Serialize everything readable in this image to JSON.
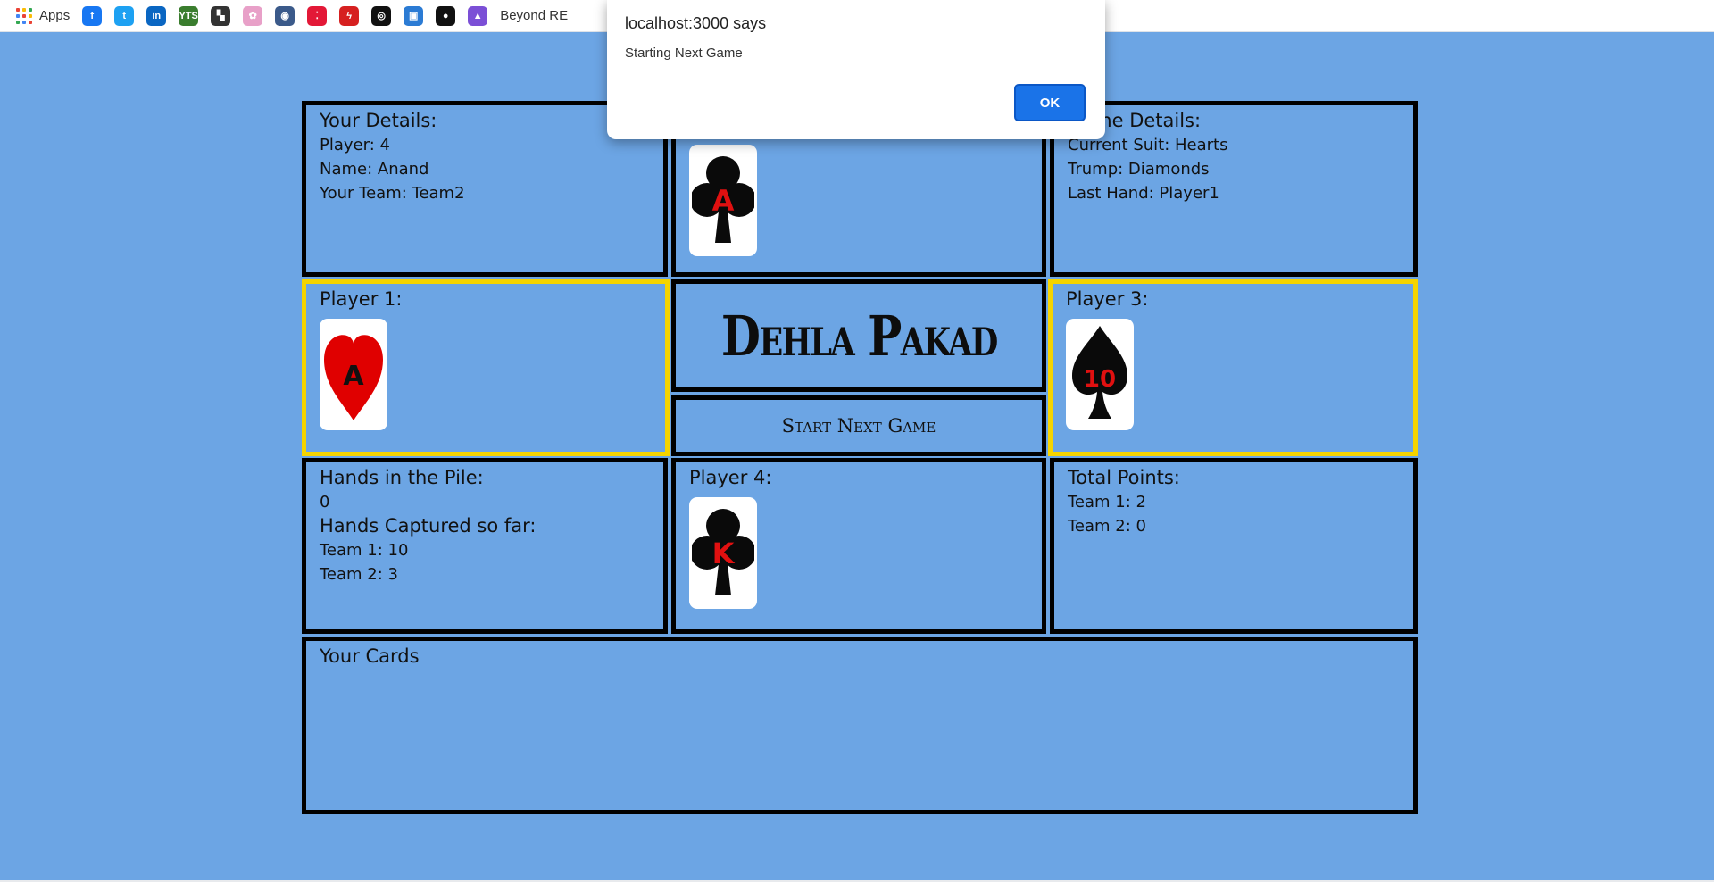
{
  "bookmarks": {
    "apps_label": "Apps",
    "items": [
      {
        "icon": "facebook-icon",
        "glyph": "f",
        "color": "#1877f2"
      },
      {
        "icon": "twitter-icon",
        "glyph": "t",
        "color": "#1da1f2"
      },
      {
        "icon": "linkedin-icon",
        "glyph": "in",
        "color": "#0a66c2"
      },
      {
        "icon": "yts-icon",
        "glyph": "YTS",
        "color": "#3a7d2e"
      },
      {
        "icon": "flag-icon",
        "glyph": "▚",
        "color": "#333333"
      },
      {
        "icon": "flower-icon",
        "glyph": "✿",
        "color": "#e8a0c8"
      },
      {
        "icon": "badge-icon",
        "glyph": "◉",
        "color": "#3b5a8a"
      },
      {
        "icon": "dominos-icon",
        "glyph": "⁚",
        "color": "#e31837"
      },
      {
        "icon": "lightning-icon",
        "glyph": "ϟ",
        "color": "#d62020"
      },
      {
        "icon": "openai-icon",
        "glyph": "◎",
        "color": "#111111"
      },
      {
        "icon": "image-icon",
        "glyph": "▣",
        "color": "#2b7bd4"
      },
      {
        "icon": "github-icon",
        "glyph": "●",
        "color": "#111111"
      },
      {
        "icon": "rocket-icon",
        "glyph": "▲",
        "color": "#7b4fd6"
      }
    ],
    "last_label": "Beyond RE"
  },
  "dialog": {
    "title": "localhost:3000 says",
    "message": "Starting Next Game",
    "ok_label": "OK"
  },
  "your_details": {
    "heading": "Your Details:",
    "player": "Player: 4",
    "name": "Name: Anand",
    "team": "Your Team: Team2"
  },
  "player2": {
    "card_rank": "A",
    "card_suit": "clubs"
  },
  "game_details": {
    "heading": "Game Details:",
    "current_suit": "Current Suit: Hearts",
    "trump": "Trump: Diamonds",
    "last_hand": "Last Hand: Player1"
  },
  "player1": {
    "heading": "Player 1:",
    "card_rank": "A",
    "card_suit": "hearts"
  },
  "title": "Dehla Pakad",
  "start_next_game": "Start Next Game",
  "player3": {
    "heading": "Player 3:",
    "card_rank": "10",
    "card_suit": "spades"
  },
  "pile": {
    "heading": "Hands in the Pile:",
    "count": "0",
    "captured_heading": "Hands Captured so far:",
    "team1": "Team 1: 10",
    "team2": "Team 2: 3"
  },
  "player4": {
    "heading": "Player 4:",
    "card_rank": "K",
    "card_suit": "clubs"
  },
  "points": {
    "heading": "Total Points:",
    "team1": "Team 1: 2",
    "team2": "Team 2: 0"
  },
  "your_cards": {
    "heading": "Your Cards"
  },
  "colors": {
    "background": "#6ca5e4",
    "active_border": "#f5d400",
    "cell_border": "#000000",
    "ok_button": "#1a73e8"
  }
}
